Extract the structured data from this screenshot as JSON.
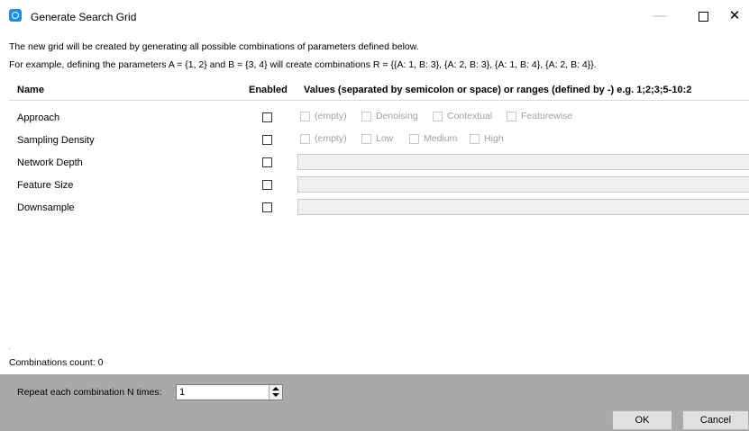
{
  "window": {
    "title": "Generate Search Grid",
    "minimize_glyph": "—",
    "close_glyph": "✕"
  },
  "description": {
    "line1": "The new grid will be created by generating all possible combinations of parameters defined below.",
    "line2": "For example, defining the parameters A = {1, 2} and B = {3, 4} will create combinations R = {{A: 1, B: 3}, {A: 2, B: 3}, {A: 1, B: 4}, {A: 2, B: 4}}."
  },
  "grid": {
    "headers": {
      "name": "Name",
      "enabled": "Enabled",
      "values": "Values (separated by semicolon or space) or ranges (defined by -) e.g. 1;2;3;5-10:2"
    },
    "rows": [
      {
        "name": "Approach",
        "enabled": false,
        "options": [
          "(empty)",
          "Denoising",
          "Contextual",
          "Featurewise"
        ]
      },
      {
        "name": "Sampling Density",
        "enabled": false,
        "options": [
          "(empty)",
          "Low",
          "Medium",
          "High"
        ]
      },
      {
        "name": "Network Depth",
        "enabled": false,
        "value": ""
      },
      {
        "name": "Feature Size",
        "enabled": false,
        "value": ""
      },
      {
        "name": "Downsample",
        "enabled": false,
        "value": ""
      }
    ]
  },
  "combinations_label": "Combinations count: 0",
  "repeat": {
    "label": "Repeat each combination N times:",
    "value": "1"
  },
  "buttons": {
    "ok": "OK",
    "cancel": "Cancel"
  },
  "colors": {
    "icon_accent": "#1a8fe3",
    "bottom_panel": "#a9a9a9",
    "disabled_text": "#a0a0a0"
  }
}
